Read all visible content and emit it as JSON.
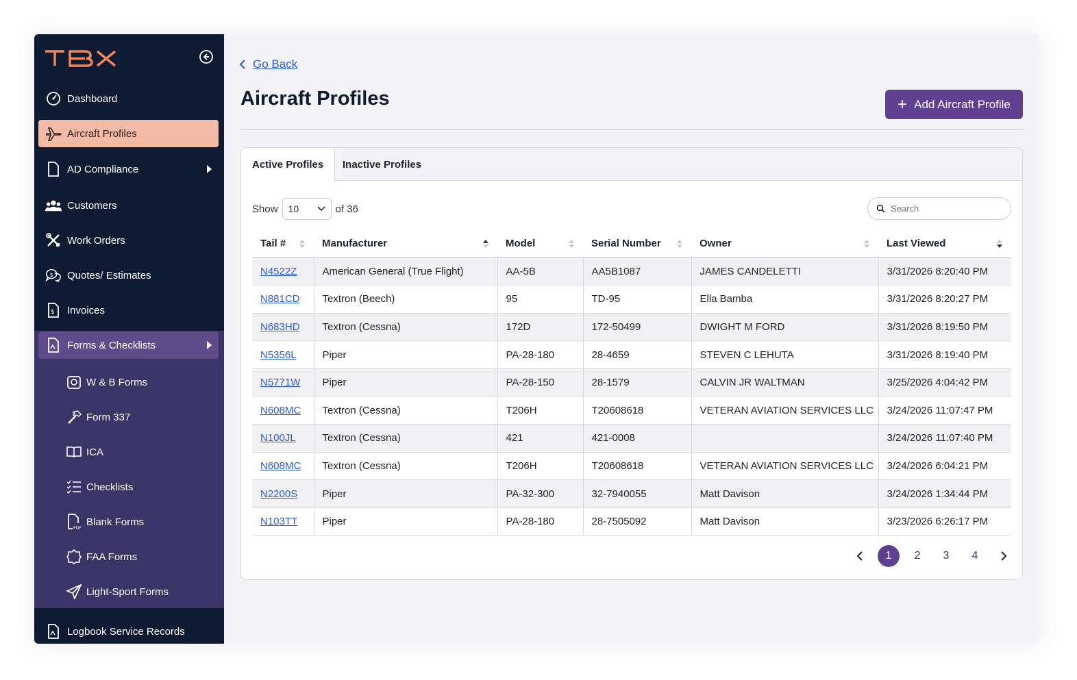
{
  "app": {
    "logo_text": "TBX",
    "accent": "#5f3f8f",
    "sidebar_bg": "#0f1a33",
    "active_bg": "#f1bba6"
  },
  "sidebar": {
    "items": [
      {
        "label": "Dashboard",
        "icon": "dashboard-icon"
      },
      {
        "label": "Aircraft Profiles",
        "icon": "airplane-icon"
      },
      {
        "label": "AD Compliance",
        "icon": "document-icon"
      },
      {
        "label": "Customers",
        "icon": "users-icon"
      },
      {
        "label": "Work Orders",
        "icon": "tools-icon"
      },
      {
        "label": "Quotes/ Estimates",
        "icon": "chat-dollar-icon"
      },
      {
        "label": "Invoices",
        "icon": "invoice-icon"
      },
      {
        "label": "Forms & Checklists",
        "icon": "forms-icon"
      }
    ],
    "sub_items": [
      {
        "label": "W & B Forms",
        "icon": "scale-icon"
      },
      {
        "label": "Form 337",
        "icon": "hammer-icon"
      },
      {
        "label": "ICA",
        "icon": "book-icon"
      },
      {
        "label": "Checklists",
        "icon": "checklist-icon"
      },
      {
        "label": "Blank Forms",
        "icon": "pdf-icon"
      },
      {
        "label": "FAA Forms",
        "icon": "badge-icon"
      },
      {
        "label": "Light-Sport Forms",
        "icon": "paper-plane-icon"
      }
    ],
    "bottom_item": {
      "label": "Logbook Service Records",
      "icon": "logbook-icon"
    }
  },
  "header": {
    "go_back": "Go Back",
    "title": "Aircraft Profiles",
    "add_button": "Add Aircraft Profile"
  },
  "tabs": [
    "Active Profiles",
    "Inactive Profiles"
  ],
  "controls": {
    "show_label": "Show",
    "page_size": "10",
    "of_total": "of 36",
    "search_placeholder": "Search"
  },
  "table": {
    "columns": [
      "Tail #",
      "Manufacturer",
      "Model",
      "Serial Number",
      "Owner",
      "Last Viewed"
    ],
    "rows": [
      [
        "N4522Z",
        "American General (True Flight)",
        "AA-5B",
        "AA5B1087",
        "JAMES CANDELETTI",
        "3/31/2026 8:20:40 PM"
      ],
      [
        "N881CD",
        "Textron (Beech)",
        "95",
        "TD-95",
        "Ella Bamba",
        "3/31/2026 8:20:27 PM"
      ],
      [
        "N683HD",
        "Textron (Cessna)",
        "172D",
        "172-50499",
        "DWIGHT M FORD",
        "3/31/2026 8:19:50 PM"
      ],
      [
        "N5356L",
        "Piper",
        "PA-28-180",
        "28-4659",
        "STEVEN C LEHUTA",
        "3/31/2026 8:19:40 PM"
      ],
      [
        "N5771W",
        "Piper",
        "PA-28-150",
        "28-1579",
        "CALVIN JR WALTMAN",
        "3/25/2026 4:04:42 PM"
      ],
      [
        "N608MC",
        "Textron (Cessna)",
        "T206H",
        "T20608618",
        "VETERAN AVIATION SERVICES LLC",
        "3/24/2026 11:07:47 PM"
      ],
      [
        "N100JL",
        "Textron (Cessna)",
        "421",
        "421-0008",
        "",
        "3/24/2026 11:07:40 PM"
      ],
      [
        "N608MC",
        "Textron (Cessna)",
        "T206H",
        "T20608618",
        "VETERAN AVIATION SERVICES LLC",
        "3/24/2026 6:04:21 PM"
      ],
      [
        "N2200S",
        "Piper",
        "PA-32-300",
        "32-7940055",
        "Matt Davison",
        "3/24/2026 1:34:44 PM"
      ],
      [
        "N103TT",
        "Piper",
        "PA-28-180",
        "28-7505092",
        "Matt Davison",
        "3/23/2026 6:26:17 PM"
      ]
    ]
  },
  "pagination": {
    "pages": [
      "1",
      "2",
      "3",
      "4"
    ],
    "current": "1"
  }
}
